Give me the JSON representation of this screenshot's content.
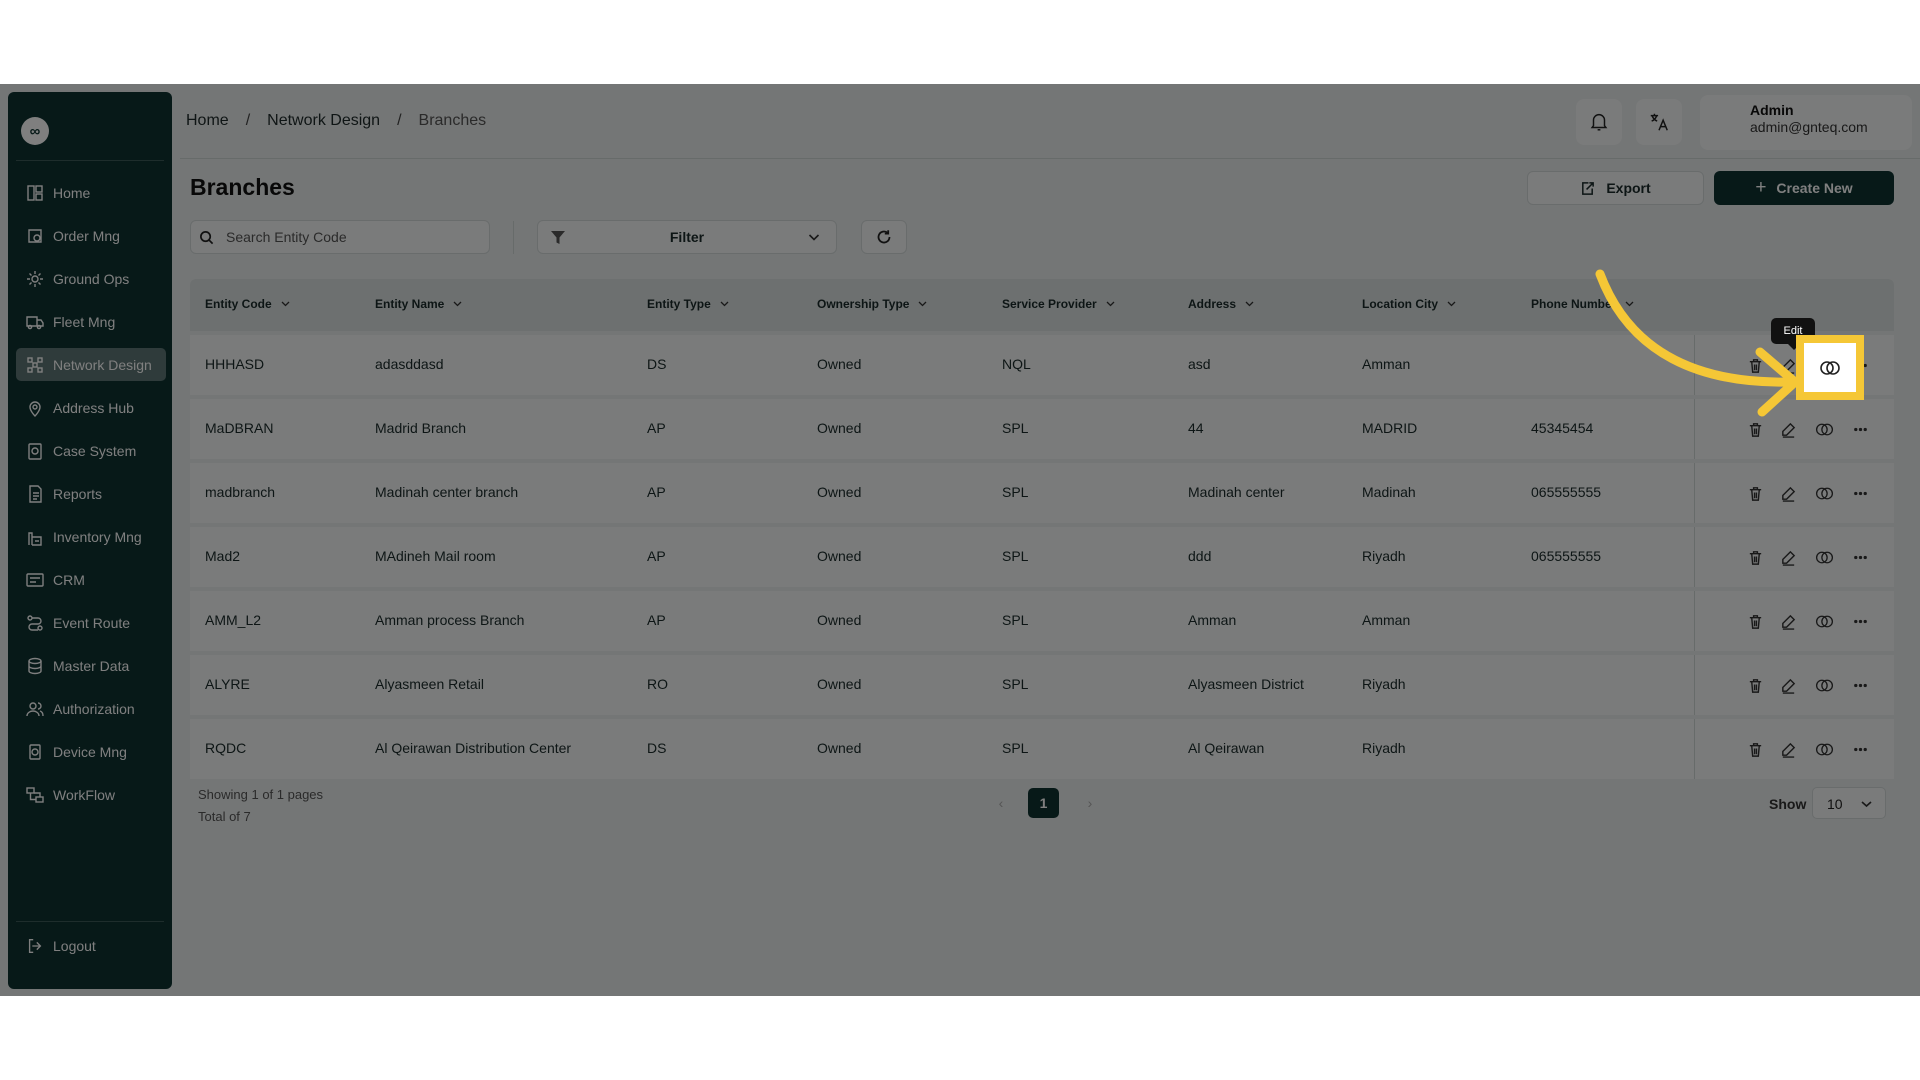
{
  "sidebar": {
    "items": [
      {
        "label": "Home",
        "icon": "home-grid-icon"
      },
      {
        "label": "Order Mng",
        "icon": "order-box-icon"
      },
      {
        "label": "Ground Ops",
        "icon": "ground-ops-icon"
      },
      {
        "label": "Fleet Mng",
        "icon": "truck-icon"
      },
      {
        "label": "Network Design",
        "icon": "network-icon",
        "active": true
      },
      {
        "label": "Address Hub",
        "icon": "map-pin-icon"
      },
      {
        "label": "Case System",
        "icon": "case-icon"
      },
      {
        "label": "Reports",
        "icon": "report-icon"
      },
      {
        "label": "Inventory Mng",
        "icon": "inventory-icon"
      },
      {
        "label": "CRM",
        "icon": "crm-icon"
      },
      {
        "label": "Event Route",
        "icon": "route-icon"
      },
      {
        "label": "Master Data",
        "icon": "database-icon"
      },
      {
        "label": "Authorization",
        "icon": "users-icon"
      },
      {
        "label": "Device Mng",
        "icon": "device-icon"
      },
      {
        "label": "WorkFlow",
        "icon": "workflow-icon"
      }
    ],
    "logout_label": "Logout",
    "logo_glyph": "∞"
  },
  "breadcrumb": {
    "home": "Home",
    "section": "Network Design",
    "current": "Branches",
    "separator": "/"
  },
  "header": {
    "user_name": "Admin",
    "user_email": "admin@gnteq.com",
    "translate_glyph": "A"
  },
  "page": {
    "title": "Branches",
    "export_label": "Export",
    "create_label": "Create New"
  },
  "toolbar": {
    "search_placeholder": "Search Entity Code",
    "filter_label": "Filter"
  },
  "table": {
    "columns": [
      "Entity Code",
      "Entity Name",
      "Entity Type",
      "Ownership Type",
      "Service Provider",
      "Address",
      "Location City",
      "Phone Number"
    ],
    "rows": [
      [
        "HHHASD",
        "adasddasd",
        "DS",
        "Owned",
        "NQL",
        "asd",
        "Amman",
        ""
      ],
      [
        "MaDBRAN",
        "Madrid Branch",
        "AP",
        "Owned",
        "SPL",
        "44",
        "MADRID",
        "45345454"
      ],
      [
        "madbranch",
        "Madinah center branch",
        "AP",
        "Owned",
        "SPL",
        "Madinah center",
        "Madinah",
        "065555555"
      ],
      [
        "Mad2",
        "MAdineh Mail room",
        "AP",
        "Owned",
        "SPL",
        "ddd",
        "Riyadh",
        "065555555"
      ],
      [
        "AMM_L2",
        "Amman process Branch",
        "AP",
        "Owned",
        "SPL",
        "Amman",
        "Amman",
        ""
      ],
      [
        "ALYRE",
        "Alyasmeen Retail",
        "RO",
        "Owned",
        "SPL",
        "Alyasmeen District",
        "Riyadh",
        ""
      ],
      [
        "RQDC",
        "Al Qeirawan Distribution Center",
        "DS",
        "Owned",
        "SPL",
        "Al Qeirawan",
        "Riyadh",
        ""
      ]
    ]
  },
  "footer": {
    "showing": "Showing 1 of 1 pages",
    "total": "Total of 7",
    "current_page": "1",
    "show_label": "Show",
    "page_size": "10"
  },
  "tooltip": {
    "text": "Edit"
  },
  "colors": {
    "sidebar": "#0e3331",
    "highlight": "#f5c736",
    "primary_button": "#0e3331"
  }
}
